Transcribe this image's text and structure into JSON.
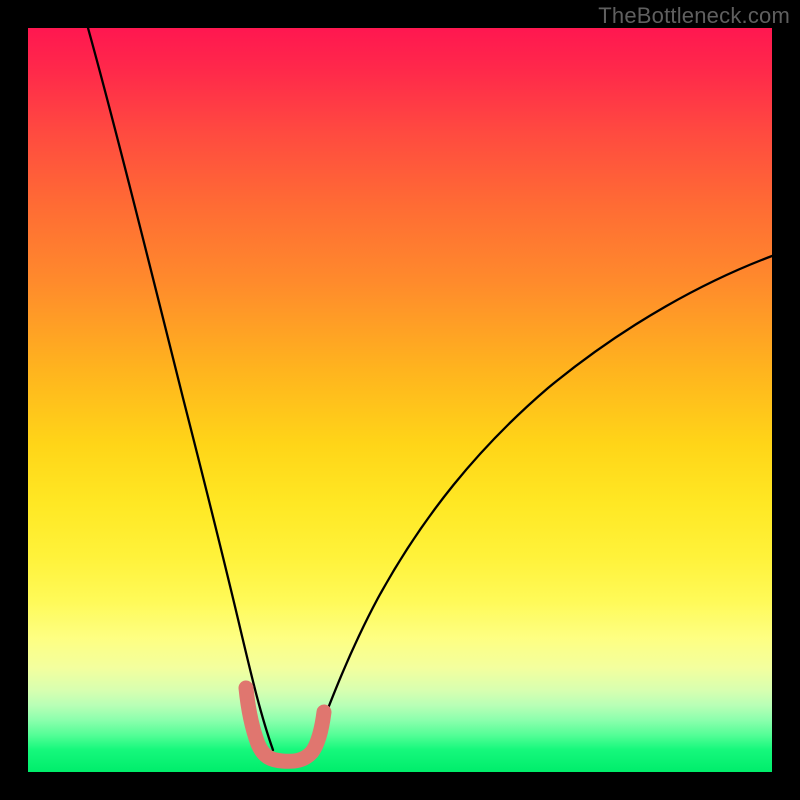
{
  "watermark": "TheBottleneck.com",
  "chart_data": {
    "type": "line",
    "title": "",
    "xlabel": "",
    "ylabel": "",
    "xlim": [
      0,
      100
    ],
    "ylim": [
      0,
      100
    ],
    "grid": false,
    "legend": false,
    "series": [
      {
        "name": "left-curve",
        "x": [
          8,
          9,
          10,
          12,
          14,
          16,
          18,
          20,
          22,
          24,
          25,
          26,
          27,
          28,
          29,
          30,
          31,
          32,
          33
        ],
        "y": [
          100,
          93,
          87,
          76,
          66,
          56,
          47,
          38,
          30,
          22,
          18,
          15,
          12,
          9,
          7,
          5,
          4,
          3,
          2.2
        ]
      },
      {
        "name": "right-curve",
        "x": [
          38,
          39,
          40,
          42,
          44,
          46,
          48,
          50,
          53,
          56,
          60,
          64,
          68,
          72,
          76,
          80,
          84,
          88,
          92,
          96,
          100
        ],
        "y": [
          2.2,
          3,
          4,
          6,
          9,
          12,
          15,
          18,
          22,
          26,
          31,
          36,
          40,
          44,
          48,
          51,
          54,
          57,
          60,
          62,
          64
        ]
      },
      {
        "name": "marker-ridge",
        "x": [
          29.5,
          30,
          31,
          32,
          33,
          34,
          35,
          36,
          37,
          38,
          38.5
        ],
        "y": [
          11,
          8,
          4,
          2.4,
          1.8,
          1.8,
          1.8,
          2.2,
          3.2,
          6,
          9
        ]
      }
    ],
    "gradient_stops": [
      {
        "pos": 0,
        "color": "#ff1750"
      },
      {
        "pos": 50,
        "color": "#ffc31c"
      },
      {
        "pos": 78,
        "color": "#feff70"
      },
      {
        "pos": 100,
        "color": "#00ed6b"
      }
    ]
  }
}
